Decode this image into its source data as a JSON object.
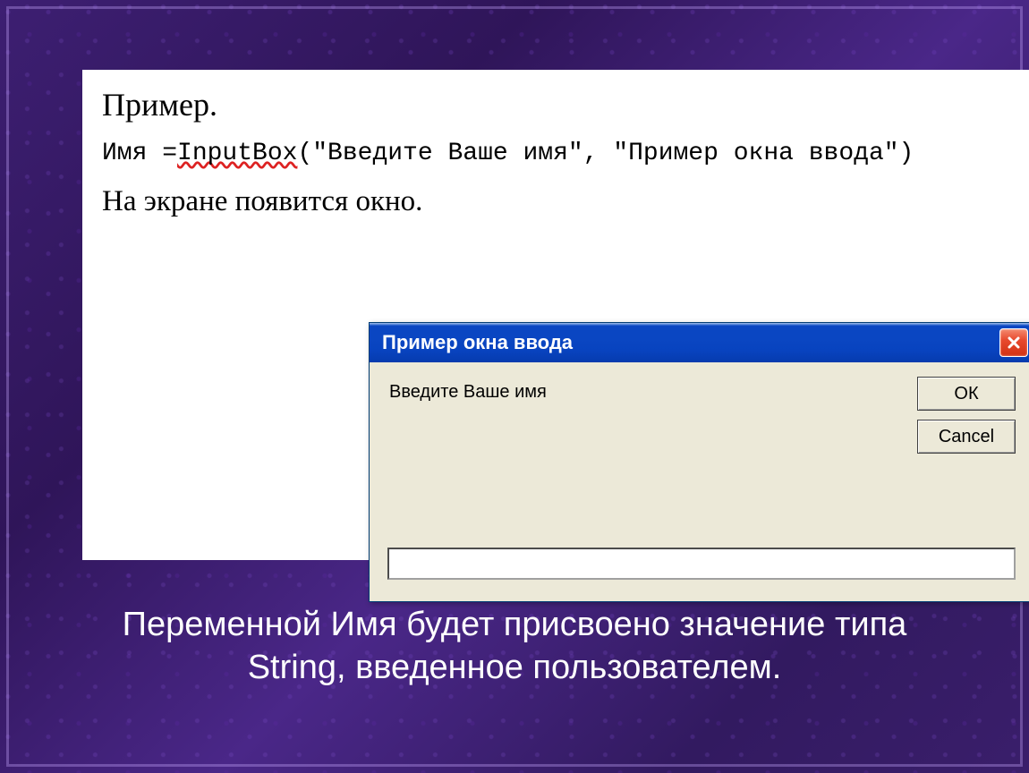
{
  "doc": {
    "heading": "Пример.",
    "code_prefix": "Имя =",
    "code_fn": "InputBox",
    "code_rest": "(\"Введите Ваше имя\", \"Пример окна ввода\")",
    "subheading": "На экране появится окно."
  },
  "dialog": {
    "title": "Пример окна ввода",
    "prompt": "Введите Ваше имя",
    "ok_label": "ОК",
    "cancel_label": "Cancel",
    "input_value": ""
  },
  "caption": "Переменной Имя будет присвоено значение типа String, введенное пользователем."
}
